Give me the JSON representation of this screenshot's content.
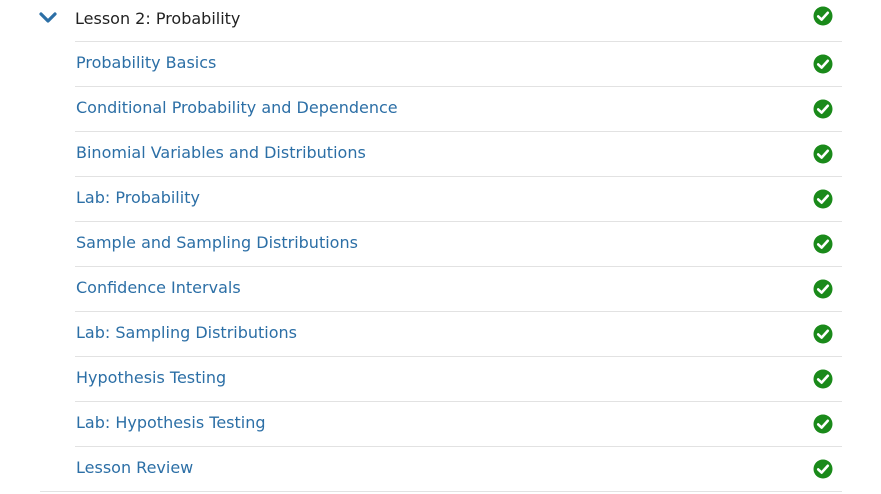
{
  "lesson": {
    "title": "Lesson 2: Probability",
    "expanded": true,
    "status_icon": "check-circle-icon",
    "complete_color": "#1a8a1a",
    "link_color": "#2c6fa6",
    "chevron_color": "#2c6fa6"
  },
  "items": [
    {
      "label": "Probability Basics",
      "status": "complete"
    },
    {
      "label": "Conditional Probability and Dependence",
      "status": "complete"
    },
    {
      "label": "Binomial Variables and Distributions",
      "status": "complete"
    },
    {
      "label": "Lab: Probability",
      "status": "complete"
    },
    {
      "label": "Sample and Sampling Distributions",
      "status": "complete"
    },
    {
      "label": "Confidence Intervals",
      "status": "complete"
    },
    {
      "label": "Lab: Sampling Distributions",
      "status": "complete"
    },
    {
      "label": "Hypothesis Testing",
      "status": "complete"
    },
    {
      "label": "Lab: Hypothesis Testing",
      "status": "complete"
    },
    {
      "label": "Lesson Review",
      "status": "complete"
    }
  ]
}
